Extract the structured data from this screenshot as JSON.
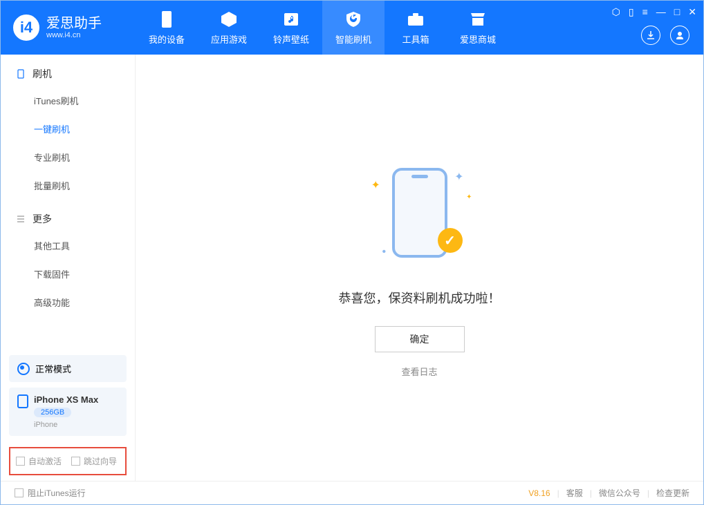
{
  "header": {
    "logo_title": "爱思助手",
    "logo_sub": "www.i4.cn",
    "nav": [
      {
        "label": "我的设备"
      },
      {
        "label": "应用游戏"
      },
      {
        "label": "铃声壁纸"
      },
      {
        "label": "智能刷机"
      },
      {
        "label": "工具箱"
      },
      {
        "label": "爱思商城"
      }
    ]
  },
  "sidebar": {
    "section1_title": "刷机",
    "section1_items": [
      "iTunes刷机",
      "一键刷机",
      "专业刷机",
      "批量刷机"
    ],
    "section2_title": "更多",
    "section2_items": [
      "其他工具",
      "下载固件",
      "高级功能"
    ],
    "mode_label": "正常模式",
    "device_name": "iPhone XS Max",
    "device_capacity": "256GB",
    "device_type": "iPhone",
    "checkbox1": "自动激活",
    "checkbox2": "跳过向导"
  },
  "main": {
    "message": "恭喜您，保资料刷机成功啦！",
    "ok_button": "确定",
    "log_link": "查看日志"
  },
  "footer": {
    "block_itunes": "阻止iTunes运行",
    "version": "V8.16",
    "links": [
      "客服",
      "微信公众号",
      "检查更新"
    ]
  }
}
